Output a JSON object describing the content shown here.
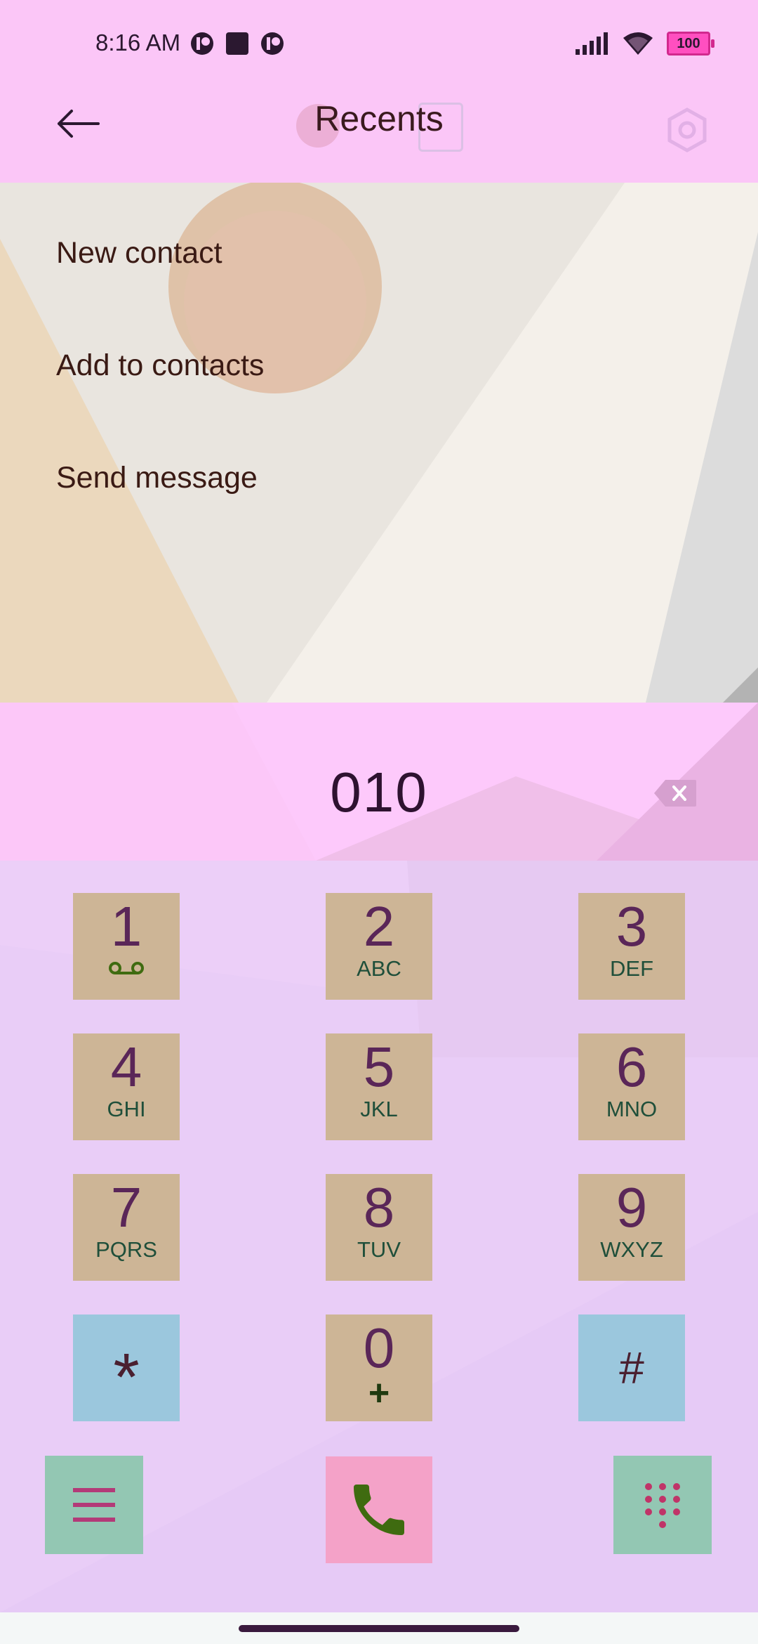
{
  "status_bar": {
    "time": "8:16 AM",
    "battery": "100",
    "icons": [
      "signal-icon",
      "wifi-icon",
      "battery-icon"
    ]
  },
  "app_bar": {
    "title": "Recents",
    "back_icon": "arrow-back-icon",
    "settings_icon": "settings-icon"
  },
  "menu": {
    "items": [
      {
        "label": "New contact"
      },
      {
        "label": "Add to contacts"
      },
      {
        "label": "Send message"
      }
    ]
  },
  "dialer": {
    "number": "010",
    "backspace_icon": "backspace-icon"
  },
  "keypad": {
    "keys": [
      {
        "digit": "1",
        "letters": ""
      },
      {
        "digit": "2",
        "letters": "ABC"
      },
      {
        "digit": "3",
        "letters": "DEF"
      },
      {
        "digit": "4",
        "letters": "GHI"
      },
      {
        "digit": "5",
        "letters": "JKL"
      },
      {
        "digit": "6",
        "letters": "MNO"
      },
      {
        "digit": "7",
        "letters": "PQRS"
      },
      {
        "digit": "8",
        "letters": "TUV"
      },
      {
        "digit": "9",
        "letters": "WXYZ"
      },
      {
        "digit": "*",
        "letters": ""
      },
      {
        "digit": "0",
        "letters": "+"
      },
      {
        "digit": "#",
        "letters": ""
      }
    ]
  },
  "bottom_actions": {
    "menu_icon": "hamburger-menu-icon",
    "call_icon": "phone-call-icon",
    "dialpad_icon": "dialpad-icon"
  },
  "colors": {
    "header": "#fbc6f7",
    "key_bg": "#cdb596",
    "symbol_key_bg": "#9bc7dd",
    "call_bg": "#f4a2c8",
    "call_icon": "#3f6b10",
    "side_action_bg": "#93c7b3"
  }
}
